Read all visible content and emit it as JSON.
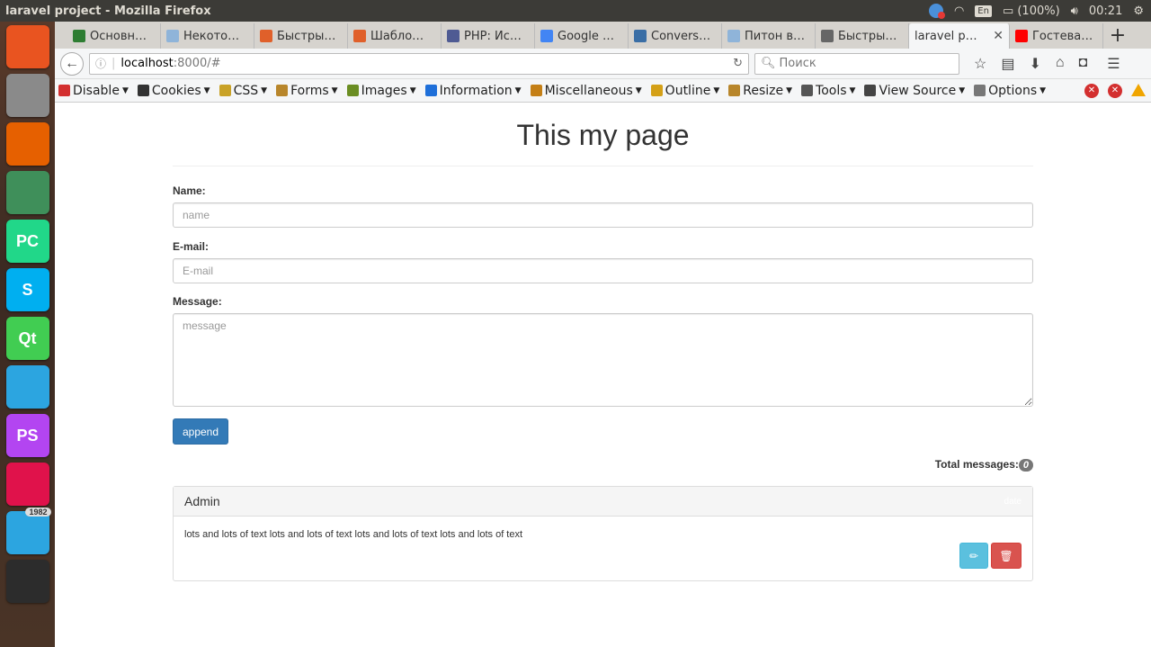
{
  "system": {
    "window_title": "laravel project - Mozilla Firefox",
    "keyboard_layout": "En",
    "battery": "(100%)",
    "clock": "00:21"
  },
  "launcher": {
    "items": [
      {
        "name": "ubuntu-dash-icon",
        "color": "#e95420"
      },
      {
        "name": "files-icon",
        "color": "#8a8a8a"
      },
      {
        "name": "firefox-icon",
        "color": "#e66000"
      },
      {
        "name": "atom-icon",
        "color": "#3f8f5a"
      },
      {
        "name": "pycharm-icon",
        "color": "#21d789",
        "text": "PC"
      },
      {
        "name": "skype-icon",
        "color": "#00aff0",
        "text": "S"
      },
      {
        "name": "qt-icon",
        "color": "#41cd52",
        "text": "Qt"
      },
      {
        "name": "telegram-icon",
        "color": "#2ca5e0"
      },
      {
        "name": "phpstorm-icon",
        "color": "#b345f1",
        "text": "PS"
      },
      {
        "name": "git-client-icon",
        "color": "#e0124b"
      },
      {
        "name": "telegram-2-icon",
        "color": "#2ca5e0",
        "badge": "1982"
      },
      {
        "name": "terminal-icon",
        "color": "#2c2c2c"
      }
    ]
  },
  "tabs": [
    {
      "label": "Основн…",
      "favicon_color": "#2e7d32"
    },
    {
      "label": "Некото…",
      "favicon_color": "#8fb4d9"
    },
    {
      "label": "Быстры…",
      "favicon_color": "#e0602a"
    },
    {
      "label": "Шабло…",
      "favicon_color": "#e0602a"
    },
    {
      "label": "PHP: Ис…",
      "favicon_color": "#4f5b93"
    },
    {
      "label": "Google …",
      "favicon_color": "#4285f4"
    },
    {
      "label": "Convers…",
      "favicon_color": "#3a6ea5"
    },
    {
      "label": "Питон в…",
      "favicon_color": "#8fb4d9"
    },
    {
      "label": "Быстры…",
      "favicon_color": "#666666"
    },
    {
      "label": "laravel p…",
      "favicon_color": "",
      "active": true
    },
    {
      "label": "Гостева…",
      "favicon_color": "#ff0000"
    }
  ],
  "nav": {
    "url_host": "localhost",
    "url_path": ":8000/#",
    "search_placeholder": "Поиск"
  },
  "webdev_toolbar": {
    "items": [
      {
        "label": "Disable",
        "icon_color": "#d32f2f"
      },
      {
        "label": "Cookies",
        "icon_color": "#333333"
      },
      {
        "label": "CSS",
        "icon_color": "#c9a227"
      },
      {
        "label": "Forms",
        "icon_color": "#b8862b"
      },
      {
        "label": "Images",
        "icon_color": "#6b8e23"
      },
      {
        "label": "Information",
        "icon_color": "#1e6fd9"
      },
      {
        "label": "Miscellaneous",
        "icon_color": "#c47f16"
      },
      {
        "label": "Outline",
        "icon_color": "#d4a017"
      },
      {
        "label": "Resize",
        "icon_color": "#b8862b"
      },
      {
        "label": "Tools",
        "icon_color": "#555555"
      },
      {
        "label": "View Source",
        "icon_color": "#444444"
      },
      {
        "label": "Options",
        "icon_color": "#777777"
      }
    ]
  },
  "page": {
    "title": "This my page",
    "form": {
      "name_label": "Name:",
      "name_placeholder": "name",
      "email_label": "E-mail:",
      "email_placeholder": "E-mail",
      "message_label": "Message:",
      "message_placeholder": "message",
      "submit_label": "append"
    },
    "total_label": "Total messages:",
    "total_count": "0",
    "message_card": {
      "author": "Admin",
      "date": "date",
      "text": "lots and lots of text lots and lots of text lots and lots of text lots and lots of text",
      "edit_icon": "✏",
      "delete_icon": "🗑"
    }
  }
}
